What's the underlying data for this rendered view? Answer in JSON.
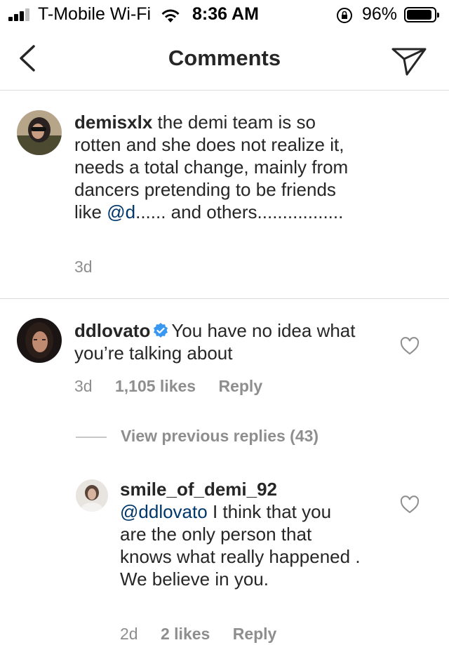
{
  "status_bar": {
    "carrier": "T-Mobile Wi-Fi",
    "time": "8:36 AM",
    "battery": "96%"
  },
  "nav": {
    "title": "Comments",
    "back_icon": "chevron-left-icon",
    "send_icon": "paper-plane-icon"
  },
  "comments": [
    {
      "username": "demisxlx",
      "text_before": "the demi team is so rotten and she does not realize it, needs a total change, mainly from dancers pretending to be friends like ",
      "mention": "@d",
      "text_after": "...... and others.................",
      "time": "3d"
    },
    {
      "username": "ddlovato",
      "verified": true,
      "text": "You have no idea what you’re talking about",
      "time": "3d",
      "likes": "1,105 likes",
      "reply_label": "Reply"
    }
  ],
  "view_previous_replies": "View previous replies (43)",
  "reply": {
    "username": "smile_of_demi_92",
    "mention": "@ddlovato",
    "text": "I think that you are the only person that knows what really happened . We believe  in you.",
    "time": "2d",
    "likes": "2 likes",
    "reply_label": "Reply"
  },
  "colors": {
    "mention": "#00376b",
    "meta": "#8e8e8e",
    "verified": "#3897f0",
    "divider": "#dbdbdb"
  }
}
